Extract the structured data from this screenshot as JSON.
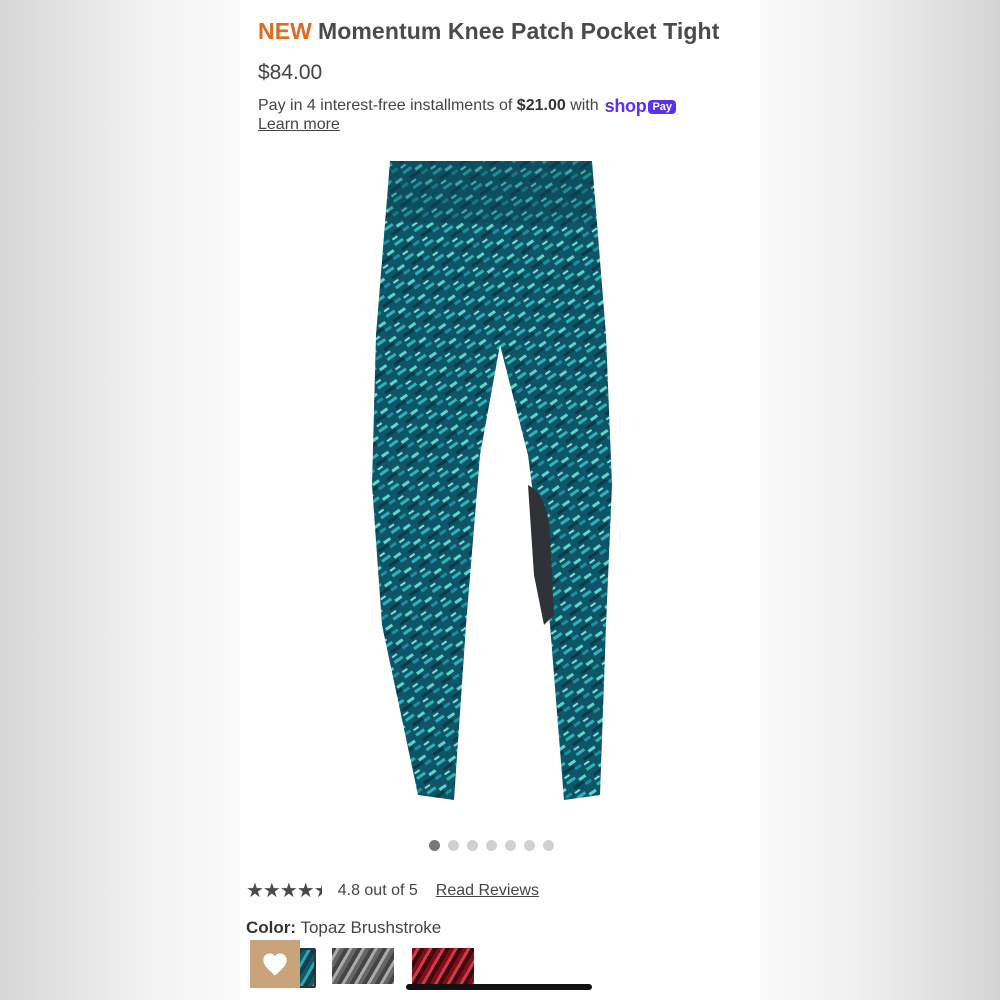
{
  "product": {
    "badge": "NEW",
    "name": "Momentum Knee Patch Pocket Tight",
    "price": "$84.00"
  },
  "installments": {
    "prefix": "Pay in 4 interest-free installments of",
    "amount": "$21.00",
    "suffix": "with",
    "shop_label": "shop",
    "pay_label": "Pay",
    "learn_more": "Learn more"
  },
  "gallery": {
    "image_count": 7,
    "active_index": 0
  },
  "rating": {
    "value": 4.8,
    "max": 5,
    "text": "4.8 out of 5",
    "reviews_link": "Read Reviews"
  },
  "color": {
    "label": "Color:",
    "selected": "Topaz Brushstroke"
  },
  "colors": {
    "brand_orange": "#e06a1e",
    "shop_pay_purple": "#5a31f4",
    "heart_button": "#c9a47a",
    "product_teal": "#0e5a6b"
  }
}
